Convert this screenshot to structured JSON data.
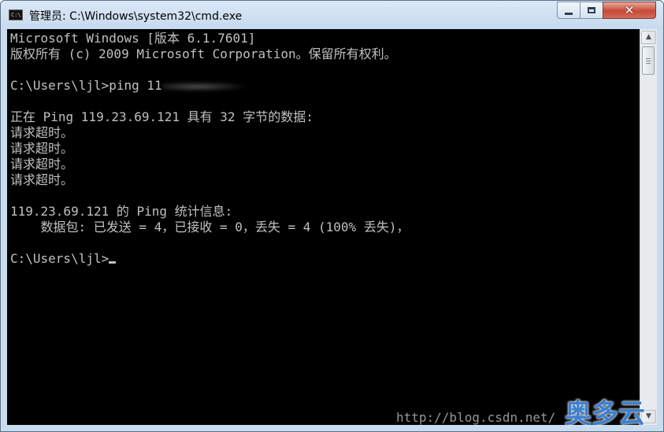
{
  "window": {
    "title": "管理员: C:\\Windows\\system32\\cmd.exe",
    "icon": "cmd-console-icon",
    "icon_text": "C:\\",
    "controls": {
      "minimize_icon": "minimize-icon",
      "maximize_icon": "maximize-icon",
      "close_icon": "close-icon",
      "close_glyph": "✕",
      "close_color": "#c74a38"
    }
  },
  "console": {
    "background": "#000000",
    "foreground": "#c0c0c0",
    "lines": [
      "Microsoft Windows [版本 6.1.7601]",
      "版权所有 (c) 2009 Microsoft Corporation。保留所有权利。",
      "",
      "C:\\Users\\ljl>ping 11",
      "",
      "正在 Ping 119.23.69.121 具有 32 字节的数据:",
      "请求超时。",
      "请求超时。",
      "请求超时。",
      "请求超时。",
      "",
      "119.23.69.121 的 Ping 统计信息:",
      "    数据包: 已发送 = 4，已接收 = 0，丢失 = 4 (100% 丢失)，",
      "",
      "C:\\Users\\ljl>"
    ]
  },
  "scrollbar": {
    "up_arrow": "▲",
    "down_arrow": "▼"
  },
  "watermark": {
    "url": "http://blog.csdn.net/",
    "logo": "奥多云"
  }
}
